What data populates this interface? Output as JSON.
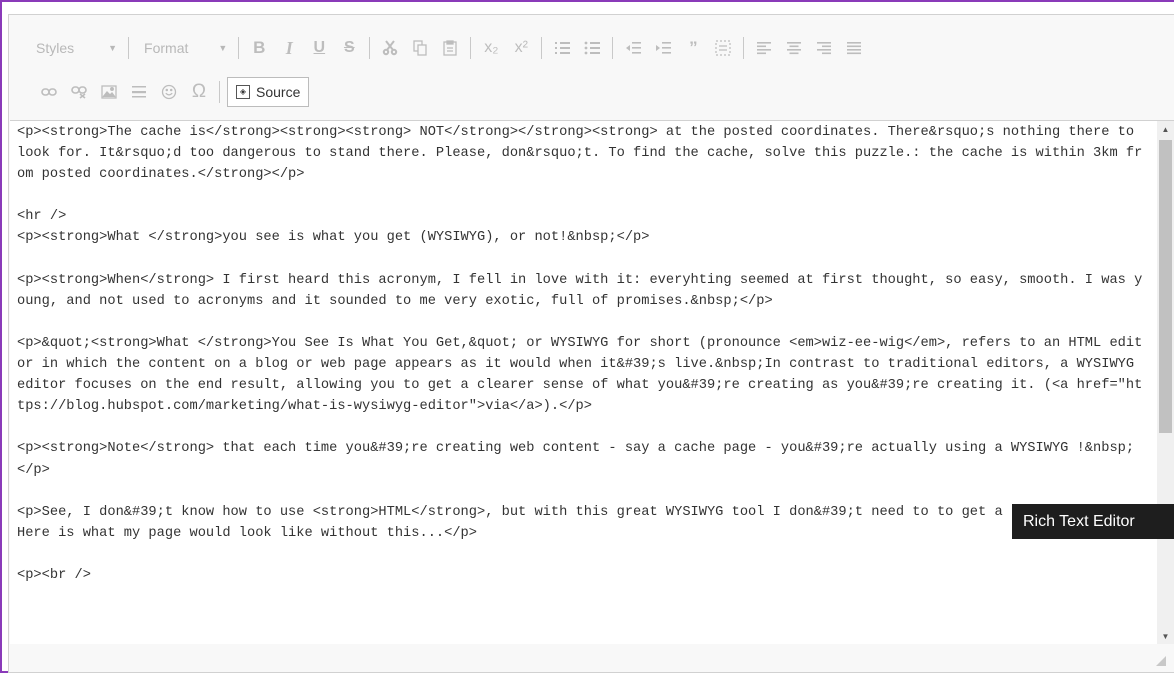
{
  "toolbar": {
    "styles_label": "Styles",
    "format_label": "Format",
    "bold": "B",
    "italic": "I",
    "underline": "U",
    "strike": "S",
    "subscript": "x₂",
    "superscript": "x²",
    "quote": "”",
    "special_char": "Ω",
    "source_label": "Source"
  },
  "content": {
    "source": "<p><strong>The cache is</strong><strong><strong> NOT</strong></strong><strong> at the posted coordinates. There&rsquo;s nothing there to look for. It&rsquo;d too dangerous to stand there. Please, don&rsquo;t. To find the cache, solve this puzzle.: the cache is within 3km from posted coordinates.</strong></p>\n\n<hr />\n<p><strong>What </strong>you see is what you get (WYSIWYG), or not!&nbsp;</p>\n\n<p><strong>When</strong> I first heard this acronym, I fell in love with it: everyhting seemed at first thought, so easy, smooth. I was young, and not used to acronyms and it sounded to me very exotic, full of promises.&nbsp;</p>\n\n<p>&quot;<strong>What </strong>You See Is What You Get,&quot; or WYSIWYG for short (pronounce <em>wiz-ee-wig</em>, refers to an HTML editor in which the content on a blog or web page appears as it would when it&#39;s live.&nbsp;In contrast to traditional editors, a WYSIWYG editor focuses on the end result, allowing you to get a clearer sense of what you&#39;re creating as you&#39;re creating it. (<a href=\"https://blog.hubspot.com/marketing/what-is-wysiwyg-editor\">via</a>).</p>\n\n<p><strong>Note</strong> that each time you&#39;re creating web content - say a cache page - you&#39;re actually using a WYSIWYG !&nbsp;</p>\n\n<p>See, I don&#39;t know how to use <strong>HTML</strong>, but with this great WYSIWYG tool I don&#39;t need to to get a nice page.&nbsp; Here is what my page would look like without this...</p>\n\n<p><br />"
  },
  "tooltip": {
    "text": "Rich Text Editor"
  },
  "colors": {
    "frame_border": "#8a3ab9",
    "toolbar_bg": "#f8f8f8",
    "icon_disabled": "#bdbdbd"
  }
}
